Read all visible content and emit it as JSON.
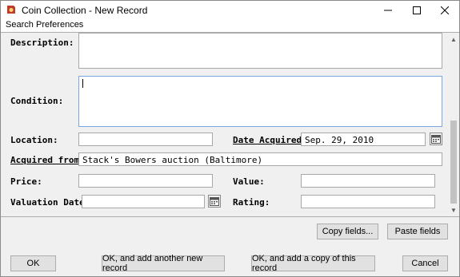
{
  "window": {
    "title": "Coin Collection - New Record"
  },
  "menu": {
    "items": [
      "Search",
      "Preferences"
    ]
  },
  "form": {
    "description": {
      "label": "Description:",
      "value": ""
    },
    "condition": {
      "label": "Condition:",
      "value": ""
    },
    "location": {
      "label": "Location:",
      "value": ""
    },
    "date_acquired": {
      "label": "Date Acquired:",
      "value": "Sep. 29, 2010"
    },
    "acquired_from": {
      "label": "Acquired from:",
      "value": "Stack's Bowers auction (Baltimore)"
    },
    "price": {
      "label": "Price:",
      "value": ""
    },
    "value": {
      "label": "Value:",
      "value": ""
    },
    "valuation_date": {
      "label": "Valuation Date:",
      "value": ""
    },
    "rating": {
      "label": "Rating:",
      "value": ""
    }
  },
  "buttons": {
    "copy_fields": "Copy fields...",
    "paste_fields": "Paste fields",
    "ok": "OK",
    "ok_add_new": "OK, and add another new record",
    "ok_add_copy": "OK, and add a copy of this record",
    "cancel": "Cancel"
  },
  "icons": {
    "app": "coin-app-icon",
    "calendar": "calendar-icon"
  }
}
